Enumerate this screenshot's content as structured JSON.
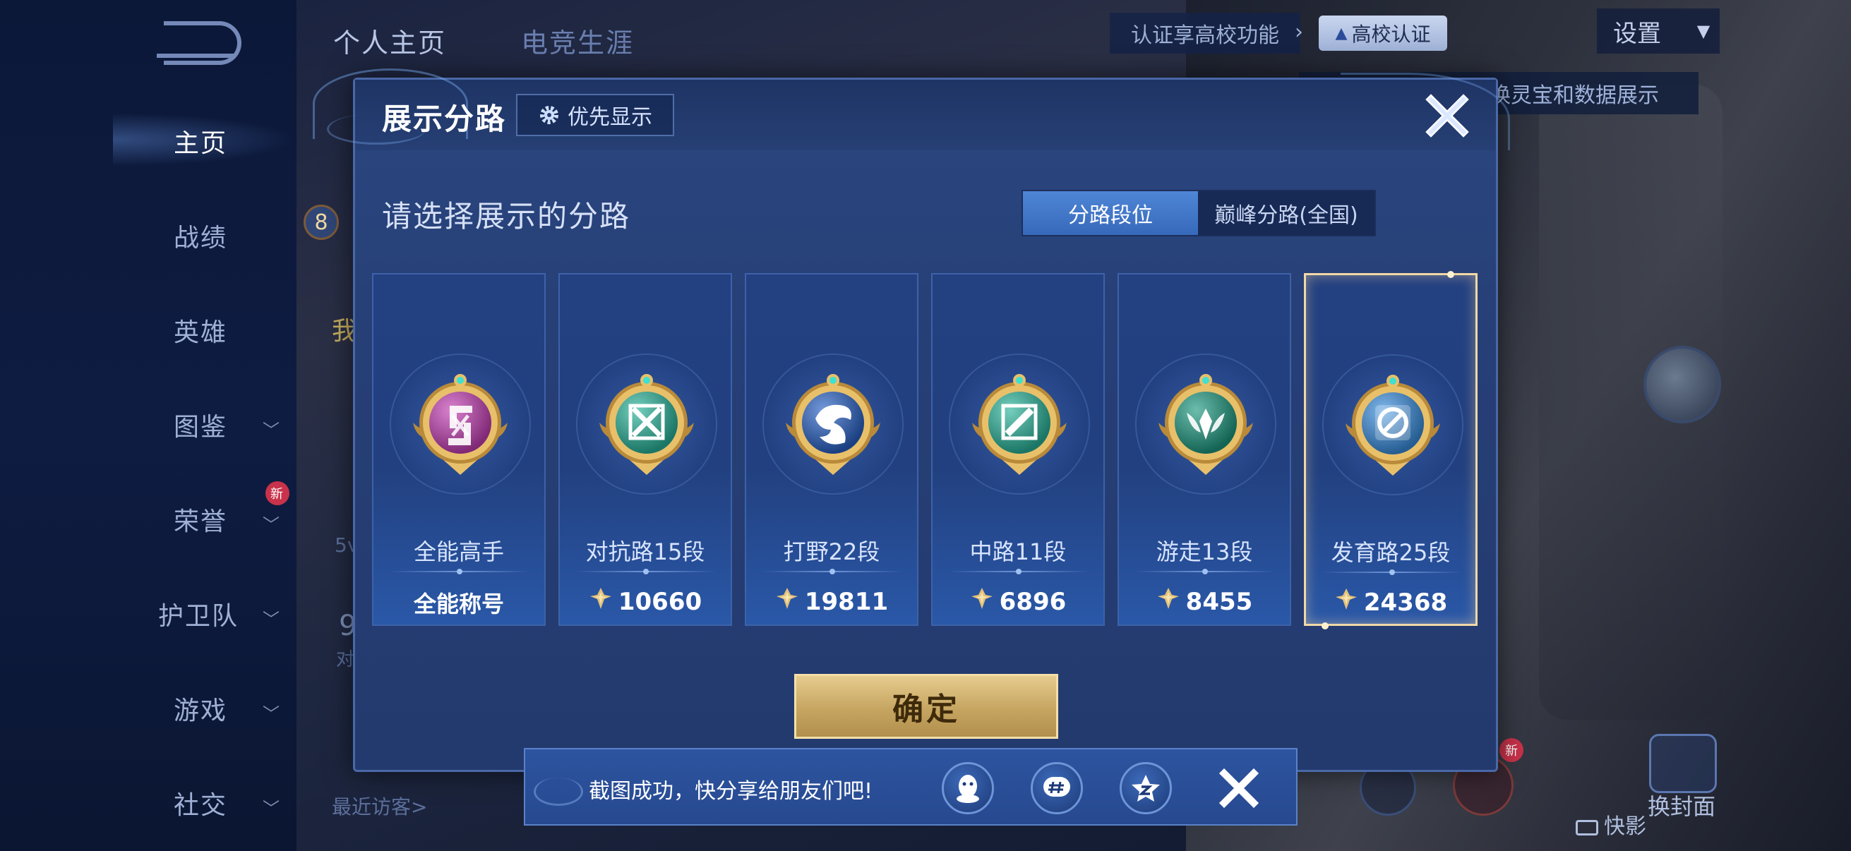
{
  "sidebar": {
    "items": [
      {
        "label": "主页",
        "active": true,
        "chevron": false,
        "badge": null
      },
      {
        "label": "战绩",
        "active": false,
        "chevron": false,
        "badge": null
      },
      {
        "label": "英雄",
        "active": false,
        "chevron": false,
        "badge": null
      },
      {
        "label": "图鉴",
        "active": false,
        "chevron": true,
        "badge": null
      },
      {
        "label": "荣誉",
        "active": false,
        "chevron": true,
        "badge": "新"
      },
      {
        "label": "护卫队",
        "active": false,
        "chevron": true,
        "badge": null
      },
      {
        "label": "游戏",
        "active": false,
        "chevron": true,
        "badge": null
      },
      {
        "label": "社交",
        "active": false,
        "chevron": true,
        "badge": null
      }
    ]
  },
  "header": {
    "tabs": [
      "个人主页",
      "电竞生涯"
    ],
    "cert_text": "认证享高校功能",
    "cert_badge": "高校认证",
    "settings": "设置",
    "ribbon_text": "换灵宝和数据展示"
  },
  "background": {
    "left_number": "8",
    "left_text_fragments": [
      "我",
      "5v",
      "9",
      "对",
      "最近访客>"
    ],
    "bottom_right": {
      "cover": "换封面",
      "badge": "新",
      "quick": "快影"
    }
  },
  "dialog": {
    "title": "展示分路",
    "pref_button": "优先显示",
    "subtitle": "请选择展示的分路",
    "segments": [
      "分路段位",
      "巅峰分路(全国)"
    ],
    "active_segment": 0,
    "cards": [
      {
        "name": "全能高手",
        "value": "全能称号",
        "has_score_icon": false,
        "emblem": "all-round",
        "color": "#c53fb5",
        "selected": false
      },
      {
        "name": "对抗路15段",
        "value": "10660",
        "has_score_icon": true,
        "emblem": "clash-lane",
        "color": "#29b59b",
        "selected": false
      },
      {
        "name": "打野22段",
        "value": "19811",
        "has_score_icon": true,
        "emblem": "jungle",
        "color": "#2a63c8",
        "selected": false
      },
      {
        "name": "中路11段",
        "value": "6896",
        "has_score_icon": true,
        "emblem": "mid-lane",
        "color": "#29b59b",
        "selected": false
      },
      {
        "name": "游走13段",
        "value": "8455",
        "has_score_icon": true,
        "emblem": "roam",
        "color": "#1f9a82",
        "selected": false
      },
      {
        "name": "发育路25段",
        "value": "24368",
        "has_score_icon": true,
        "emblem": "farm-lane",
        "color": "#3a8fe0",
        "selected": true
      }
    ],
    "confirm": "确定"
  },
  "toast": {
    "message": "截图成功，快分享给朋友们吧!",
    "share_icons": [
      "qq-icon",
      "wechat-moments-icon",
      "qzone-icon"
    ]
  }
}
